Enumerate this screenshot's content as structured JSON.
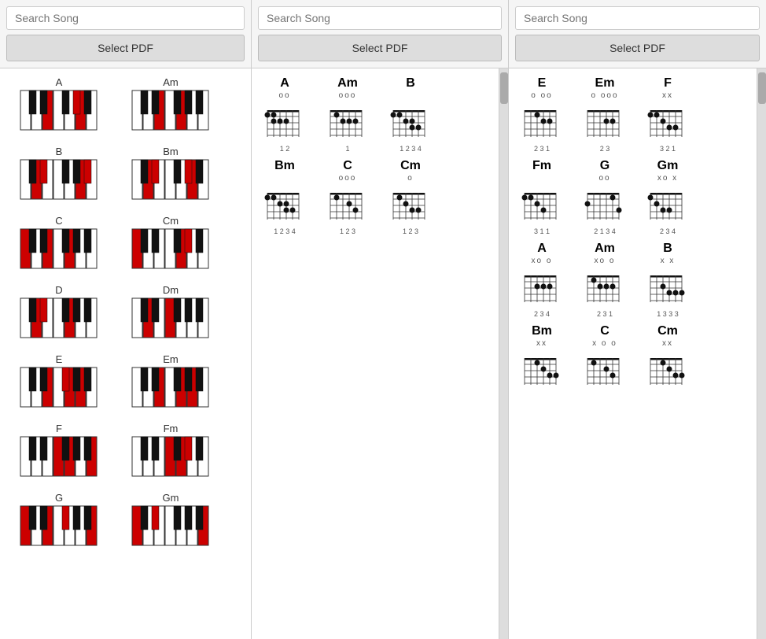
{
  "columns": [
    {
      "id": "left",
      "search_placeholder": "Search Song",
      "btn_label": "Select PDF",
      "chords": [
        {
          "name": "A",
          "whites": [
            1,
            0,
            0,
            1,
            0,
            1,
            0
          ],
          "blacks": [
            0,
            1,
            0,
            0,
            1,
            0,
            0,
            0,
            0,
            1,
            0,
            0
          ]
        },
        {
          "name": "Am",
          "whites": [
            1,
            0,
            0,
            1,
            0,
            1,
            0
          ],
          "blacks": [
            0,
            0,
            1,
            0,
            0,
            1,
            0,
            0,
            0,
            0,
            1,
            0
          ]
        },
        {
          "name": "B",
          "whites": [
            0,
            1,
            0,
            0,
            1,
            0,
            1
          ],
          "blacks": [
            1,
            0,
            0,
            1,
            0,
            0,
            0,
            1,
            0,
            0,
            0,
            1
          ]
        },
        {
          "name": "Bm",
          "whites": [
            0,
            1,
            0,
            0,
            1,
            0,
            1
          ],
          "blacks": [
            0,
            0,
            1,
            0,
            0,
            0,
            1,
            0,
            0,
            0,
            0,
            1
          ]
        },
        {
          "name": "C",
          "whites": [
            1,
            0,
            1,
            0,
            0,
            1,
            0
          ],
          "blacks": [
            0,
            0,
            0,
            1,
            0,
            1,
            0,
            0,
            0,
            0,
            0,
            0
          ]
        },
        {
          "name": "Cm",
          "whites": [
            1,
            0,
            0,
            1,
            0,
            0,
            1
          ],
          "blacks": [
            0,
            0,
            0,
            0,
            1,
            0,
            1,
            0,
            0,
            0,
            0,
            1
          ]
        },
        {
          "name": "D",
          "whites": [
            0,
            1,
            0,
            1,
            0,
            0,
            1
          ],
          "blacks": [
            0,
            1,
            0,
            0,
            0,
            0,
            1,
            0,
            0,
            0,
            0,
            0
          ]
        },
        {
          "name": "Dm",
          "whites": [
            0,
            1,
            0,
            0,
            1,
            0,
            0
          ],
          "blacks": [
            0,
            0,
            1,
            0,
            0,
            1,
            0,
            0,
            0,
            0,
            0,
            0
          ]
        },
        {
          "name": "E",
          "whites": [
            1,
            0,
            1,
            0,
            1,
            0,
            1
          ],
          "blacks": [
            1,
            0,
            0,
            1,
            0,
            0,
            0,
            0,
            1,
            0,
            0,
            0
          ]
        },
        {
          "name": "Em",
          "whites": [
            1,
            0,
            1,
            0,
            0,
            1,
            0
          ],
          "blacks": [
            0,
            0,
            0,
            1,
            0,
            0,
            0,
            1,
            0,
            0,
            0,
            0
          ]
        },
        {
          "name": "F",
          "whites": [
            1,
            0,
            1,
            0,
            0,
            1,
            0
          ],
          "blacks": [
            0,
            0,
            0,
            0,
            1,
            1,
            0,
            0,
            0,
            0,
            0,
            0
          ]
        },
        {
          "name": "Fm",
          "whites": [
            1,
            0,
            0,
            1,
            0,
            1,
            0
          ],
          "blacks": [
            0,
            0,
            0,
            0,
            0,
            0,
            1,
            0,
            1,
            0,
            0,
            0
          ]
        },
        {
          "name": "G",
          "whites": [
            1,
            0,
            1,
            0,
            1,
            0,
            1
          ],
          "blacks": [
            0,
            1,
            0,
            0,
            1,
            0,
            0,
            0,
            0,
            0,
            1,
            0
          ]
        },
        {
          "name": "Gm",
          "whites": [
            1,
            0,
            0,
            1,
            0,
            1,
            0
          ],
          "blacks": [
            0,
            0,
            1,
            0,
            0,
            0,
            1,
            0,
            0,
            0,
            0,
            0
          ]
        }
      ]
    },
    {
      "id": "mid",
      "search_placeholder": "Search Song",
      "btn_label": "Select PDF"
    },
    {
      "id": "right",
      "search_placeholder": "Search Song",
      "btn_label": "Select PDF"
    }
  ],
  "mid_guitar_chords": [
    {
      "name": "A",
      "open": "oo",
      "fingers": "1 2",
      "dots": [
        [
          1,
          1
        ],
        [
          1,
          2
        ],
        [
          2,
          2
        ],
        [
          2,
          3
        ],
        [
          2,
          4
        ]
      ]
    },
    {
      "name": "Am",
      "open": "ooo",
      "fingers": "1",
      "dots": [
        [
          1,
          2
        ],
        [
          2,
          3
        ],
        [
          2,
          4
        ],
        [
          2,
          5
        ]
      ]
    },
    {
      "name": "B",
      "open": "",
      "fingers": "1 2 3 4",
      "dots": [
        [
          1,
          1
        ],
        [
          1,
          2
        ],
        [
          2,
          3
        ],
        [
          2,
          4
        ],
        [
          3,
          4
        ],
        [
          3,
          5
        ]
      ]
    },
    {
      "name": "Bm",
      "open": "",
      "fingers": "1 2 3 4",
      "dots": [
        [
          1,
          1
        ],
        [
          1,
          2
        ],
        [
          2,
          3
        ],
        [
          2,
          4
        ],
        [
          3,
          4
        ],
        [
          3,
          5
        ]
      ]
    },
    {
      "name": "C",
      "open": "ooo",
      "fingers": "1 2 3",
      "dots": [
        [
          1,
          2
        ],
        [
          2,
          4
        ],
        [
          3,
          5
        ]
      ]
    },
    {
      "name": "Cm",
      "open": "o",
      "fingers": "1 2 3",
      "dots": [
        [
          1,
          2
        ],
        [
          2,
          3
        ],
        [
          3,
          4
        ],
        [
          3,
          5
        ]
      ]
    }
  ],
  "right_guitar_chords": [
    {
      "name": "E",
      "open": "o oo",
      "fingers": "2 3 1",
      "dots": [
        [
          1,
          3
        ],
        [
          2,
          5
        ],
        [
          2,
          4
        ]
      ]
    },
    {
      "name": "Em",
      "open": "o ooo",
      "fingers": "2 3",
      "dots": [
        [
          2,
          4
        ],
        [
          2,
          5
        ]
      ]
    },
    {
      "name": "F",
      "open": "xx",
      "fingers": "3 2 1",
      "dots": [
        [
          1,
          1
        ],
        [
          1,
          2
        ],
        [
          2,
          3
        ],
        [
          3,
          4
        ],
        [
          3,
          5
        ]
      ]
    },
    {
      "name": "Fm",
      "open": "",
      "fingers": "3 1 1",
      "dots": [
        [
          1,
          1
        ],
        [
          1,
          2
        ],
        [
          2,
          3
        ],
        [
          3,
          4
        ]
      ]
    },
    {
      "name": "G",
      "open": "oo",
      "fingers": "2 1 3 4",
      "dots": [
        [
          1,
          5
        ],
        [
          2,
          1
        ],
        [
          3,
          6
        ]
      ]
    },
    {
      "name": "Gm",
      "open": "xo x",
      "fingers": "2 3 4",
      "dots": [
        [
          1,
          1
        ],
        [
          2,
          2
        ],
        [
          3,
          3
        ],
        [
          3,
          4
        ]
      ]
    },
    {
      "name": "A",
      "open": "xo  o",
      "fingers": "2 3 4",
      "dots": [
        [
          2,
          3
        ],
        [
          2,
          4
        ],
        [
          2,
          5
        ]
      ]
    },
    {
      "name": "Am",
      "open": "xo  o",
      "fingers": "2 3 1",
      "dots": [
        [
          1,
          2
        ],
        [
          2,
          3
        ],
        [
          2,
          4
        ],
        [
          2,
          5
        ]
      ]
    },
    {
      "name": "B",
      "open": "x  x",
      "fingers": "1 3 3 3",
      "dots": [
        [
          2,
          3
        ],
        [
          3,
          4
        ],
        [
          3,
          5
        ],
        [
          3,
          6
        ]
      ]
    },
    {
      "name": "Bm",
      "open": "xx",
      "fingers": "",
      "dots": [
        [
          1,
          3
        ],
        [
          2,
          4
        ],
        [
          3,
          5
        ],
        [
          3,
          6
        ]
      ]
    },
    {
      "name": "C",
      "open": "x o o",
      "fingers": "",
      "dots": [
        [
          1,
          2
        ],
        [
          2,
          4
        ],
        [
          3,
          5
        ]
      ]
    },
    {
      "name": "Cm",
      "open": "xx",
      "fingers": "",
      "dots": [
        [
          1,
          3
        ],
        [
          2,
          4
        ],
        [
          3,
          5
        ],
        [
          3,
          6
        ]
      ]
    }
  ]
}
